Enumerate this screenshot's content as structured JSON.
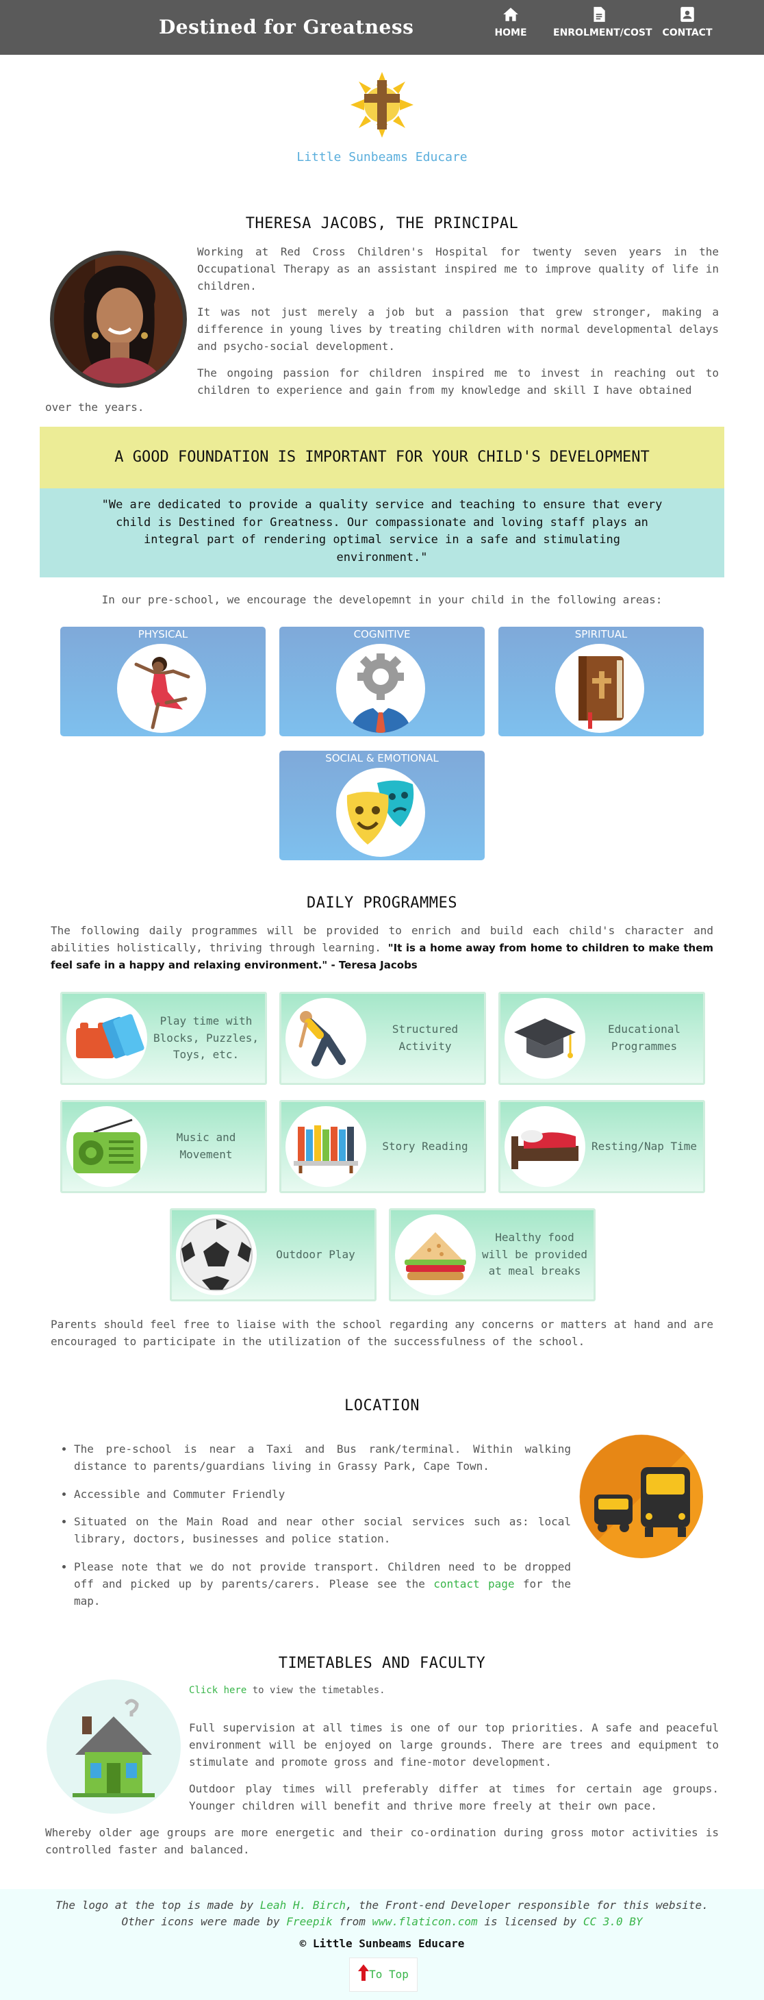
{
  "nav": {
    "brand": "Destined for Greatness",
    "items": [
      {
        "label": "HOME",
        "icon": "home-icon"
      },
      {
        "label": "ENROLMENT/COST",
        "icon": "document-icon"
      },
      {
        "label": "CONTACT",
        "icon": "contact-card-icon"
      }
    ]
  },
  "site": {
    "name": "Little Sunbeams Educare"
  },
  "principal": {
    "heading": "THERESA JACOBS, THE PRINCIPAL",
    "p1": "Working at Red Cross Children's Hospital for twenty seven years in the Occupational Therapy as an assistant inspired me to improve quality of life in children.",
    "p2": "It was not just merely a job but a passion that grew stronger, making a difference in young lives by treating children with normal developmental delays and psycho-social development.",
    "p3a": "The ongoing passion for children inspired me to invest in reaching out to children to experience and gain from my knowledge and skill I have obtained",
    "p3b": "over the years."
  },
  "foundation": {
    "heading": "A GOOD FOUNDATION IS IMPORTANT FOR YOUR CHILD'S DEVELOPMENT",
    "quote": "\"We are dedicated to provide a quality service and teaching to ensure that every child is Destined for Greatness. Our compassionate and loving staff plays an integral part of rendering optimal service in a safe and stimulating environment.\""
  },
  "areas": {
    "intro": "In our pre-school, we encourage the developemnt in your child in the following areas:",
    "items": [
      {
        "label": "PHYSICAL",
        "icon": "dancer-icon"
      },
      {
        "label": "COGNITIVE",
        "icon": "gear-head-icon"
      },
      {
        "label": "SPIRITUAL",
        "icon": "bible-icon"
      },
      {
        "label": "SOCIAL & EMOTIONAL",
        "icon": "theatre-masks-icon"
      }
    ]
  },
  "programmes": {
    "heading": "DAILY PROGRAMMES",
    "intro": "The following daily programmes will be provided to enrich and build each child's character and abilities holistically, thriving through learning.",
    "quote": "\"It is a home away from home to children to make them feel safe in a happy and relaxing environment.\" - Teresa Jacobs",
    "items": [
      {
        "label": "Play time with Blocks, Puzzles, Toys, etc.",
        "icon": "building-blocks-icon"
      },
      {
        "label": "Structured Activity",
        "icon": "stretching-person-icon"
      },
      {
        "label": "Educational Programmes",
        "icon": "graduation-cap-icon"
      },
      {
        "label": "Music and Movement",
        "icon": "radio-icon"
      },
      {
        "label": "Story Reading",
        "icon": "bookshelf-icon"
      },
      {
        "label": "Resting/Nap Time",
        "icon": "bed-icon"
      },
      {
        "label": "Outdoor Play",
        "icon": "soccer-ball-icon"
      },
      {
        "label": "Healthy food will be provided at meal breaks",
        "icon": "sandwich-icon"
      }
    ],
    "closing": "Parents should feel free to liaise with the school regarding any concerns or matters at hand and are encouraged to participate in the utilization of the successfulness of the school."
  },
  "location": {
    "heading": "LOCATION",
    "items": [
      "The pre-school is near a Taxi and Bus rank/terminal. Within walking distance to parents/guardians living in Grassy Park, Cape Town.",
      "Accessible and Commuter Friendly",
      "Situated on the Main Road and near other social services such as: local library, doctors, businesses and police station."
    ],
    "last_before": "Please note that we do not provide transport. Children need to be dropped off and picked up by parents/carers. Please see the",
    "last_link": "contact page",
    "last_after": "for the map.",
    "icon": "taxi-bus-icon"
  },
  "timetables": {
    "heading": "TIMETABLES AND FACULTY",
    "link": "Click here",
    "link_after": "to view the timetables.",
    "p1": "Full supervision at all times is one of our top priorities. A safe and peaceful environment will be enjoyed on large grounds. There are trees and equipment to stimulate and promote gross and fine-motor development.",
    "p2": "Outdoor play times will preferably differ at times for certain age groups. Younger children will benefit and thrive more freely at their own pace.",
    "p3": "Whereby older age groups are more energetic and their co-ordination during gross motor activities is controlled faster and balanced.",
    "icon": "house-icon"
  },
  "footer": {
    "l1_a": "The logo at the top is made by",
    "l1_link": "Leah H. Birch",
    "l1_b": ", the Front-end Developer responsible for this website.",
    "l2_a": "Other icons were made by",
    "l2_link1": "Freepik",
    "l2_b": "from",
    "l2_link2": "www.flaticon.com",
    "l2_c": "is licensed by",
    "l2_link3": "CC 3.0 BY",
    "copyright": "© Little Sunbeams Educare",
    "to_top": "To Top"
  }
}
